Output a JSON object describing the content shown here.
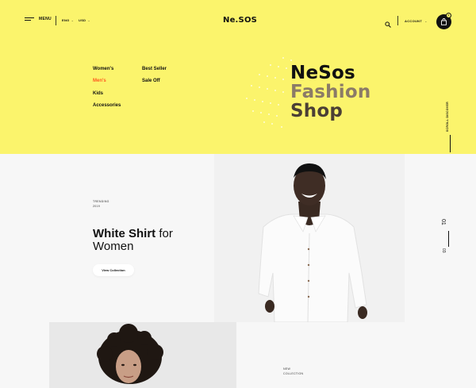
{
  "header": {
    "menu_label": "MENU",
    "language": "ENG",
    "currency": "USD",
    "logo": "Ne.SOS",
    "account_label": "ACCOUNT",
    "cart_count": "0"
  },
  "categories": {
    "col1": [
      "Women's",
      "Men's",
      "Kids",
      "Accessories"
    ],
    "col2": [
      "Best Seller",
      "Sale Off"
    ],
    "active": "Men's"
  },
  "hero": {
    "title_line1": "NeSos",
    "title_line2": "Fashion",
    "title_line3": "Shop",
    "scroll_label": "SCROLL DISCOVER"
  },
  "feature": {
    "tag_line1": "TRENDING",
    "tag_line2": "2019",
    "title_bold": "White Shirt",
    "title_rest": " for",
    "title_line2": "Women",
    "button_label": "View Collection",
    "slide_current": "01",
    "slide_total": "03"
  },
  "collection": {
    "tag_line1": "NEW",
    "tag_line2": "COLLECTION"
  },
  "colors": {
    "accent_yellow": "#fbf46c",
    "active_orange": "#ff5a1f",
    "text_dark": "#111111"
  }
}
